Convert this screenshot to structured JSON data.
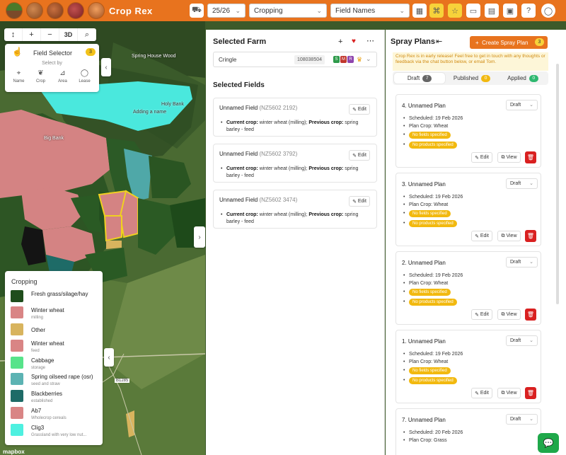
{
  "app": {
    "title": "Crop Rex",
    "season": "25/26",
    "layer_select": "Cropping",
    "label_select": "Field Names"
  },
  "map": {
    "toolbar": [
      "↕",
      "+",
      "−",
      "3D",
      "⌕"
    ],
    "labels": {
      "wood": "Spring House Wood",
      "holy_bank": "Holy Bank",
      "adding": "Adding a name",
      "big_bank": "Big Bank",
      "road": "B1285"
    },
    "mapbox": "mapbox",
    "field_selector": {
      "title": "Field Selector",
      "count": "3",
      "select_by": "Select by",
      "options": [
        {
          "label": "Name",
          "icon": "tag-icon"
        },
        {
          "label": "Crop",
          "icon": "leaf-icon"
        },
        {
          "label": "Area",
          "icon": "chart-icon"
        },
        {
          "label": "Lease",
          "icon": "chat-icon"
        }
      ]
    },
    "legend": {
      "title": "Cropping",
      "items": [
        {
          "name": "Fresh grass/silage/hay",
          "sub": "",
          "color": "#1f4d1c"
        },
        {
          "name": "Winter wheat",
          "sub": "milling",
          "color": "#d98585"
        },
        {
          "name": "Other",
          "sub": "",
          "color": "#d8b45e"
        },
        {
          "name": "Winter wheat",
          "sub": "feed",
          "color": "#d98585"
        },
        {
          "name": "Cabbage",
          "sub": "storage",
          "color": "#57e38a"
        },
        {
          "name": "Spring oilseed rape (osr)",
          "sub": "seed and straw",
          "color": "#5cb3b3"
        },
        {
          "name": "Blackberries",
          "sub": "established",
          "color": "#1e6b67"
        },
        {
          "name": "Ab7",
          "sub": "Wholecrop cereals",
          "color": "#d98585"
        },
        {
          "name": "Clig3",
          "sub": "Grassland with very low nut...",
          "color": "#4ef0e0"
        }
      ]
    }
  },
  "farm": {
    "title": "Selected Farm",
    "name": "Cringle",
    "id": "108038504",
    "tags": [
      {
        "letter": "S",
        "color": "#2e9a4a"
      },
      {
        "letter": "M",
        "color": "#c0362c"
      },
      {
        "letter": "R",
        "color": "#8e44ad"
      }
    ],
    "fields_title": "Selected Fields",
    "edit_label": "Edit",
    "current_crop_label": "Current crop:",
    "previous_crop_label": "Previous crop:",
    "fields": [
      {
        "name": "Unnamed Field",
        "code": "(NZ5602 2192)",
        "current": "winter wheat (milling);",
        "previous": "spring barley - feed"
      },
      {
        "name": "Unnamed Field",
        "code": "(NZ5602 3792)",
        "current": "winter wheat (milling);",
        "previous": "spring barley - feed"
      },
      {
        "name": "Unnamed Field",
        "code": "(NZ5602 3474)",
        "current": "winter wheat (milling);",
        "previous": "spring barley - feed"
      }
    ]
  },
  "spray": {
    "title": "Spray Plans",
    "create_label": "Create Spray Plan",
    "create_count": "3",
    "notice": "Crop Rex is in early release! Feel free to get in touch with any thoughts or feedback via the chat button below, or email Tom.",
    "tabs": [
      {
        "label": "Draft",
        "count": "7",
        "color": "#666666"
      },
      {
        "label": "Published",
        "count": "0",
        "color": "#f2b90f"
      },
      {
        "label": "Applied",
        "count": "0",
        "color": "#2eb870"
      }
    ],
    "edit_label": "Edit",
    "view_label": "View",
    "no_fields": "No fields specified",
    "no_products": "No products specified",
    "plans": [
      {
        "title": "4. Unnamed Plan",
        "status": "Draft",
        "scheduled": "Scheduled: 19 Feb 2026",
        "crop": "Plan Crop: Wheat"
      },
      {
        "title": "3. Unnamed Plan",
        "status": "Draft",
        "scheduled": "Scheduled: 19 Feb 2026",
        "crop": "Plan Crop: Wheat"
      },
      {
        "title": "2. Unnamed Plan",
        "status": "Draft",
        "scheduled": "Scheduled: 19 Feb 2026",
        "crop": "Plan Crop: Wheat"
      },
      {
        "title": "1. Unnamed Plan",
        "status": "Draft",
        "scheduled": "Scheduled: 19 Feb 2026",
        "crop": "Plan Crop: Wheat"
      },
      {
        "title": "7. Unnamed Plan",
        "status": "Draft",
        "scheduled": "Scheduled: 20 Feb 2026",
        "crop": "Plan Crop: Grass"
      }
    ]
  }
}
